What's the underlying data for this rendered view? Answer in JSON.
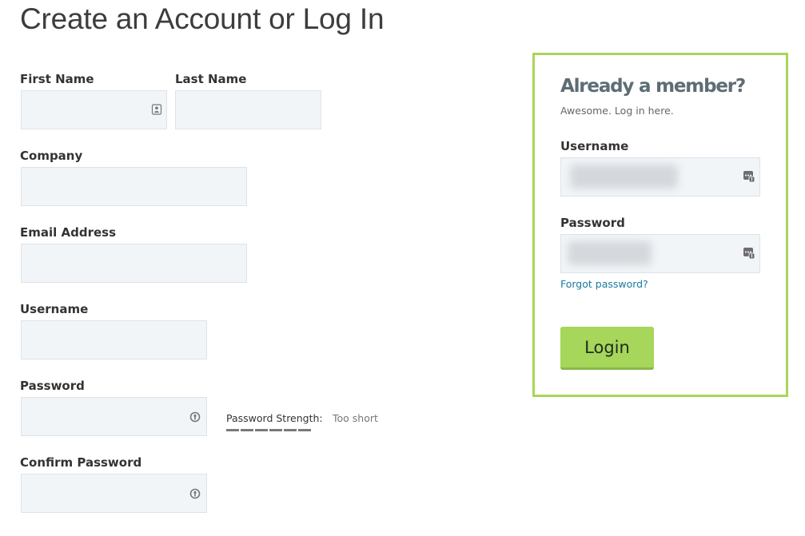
{
  "page": {
    "title": "Create an Account or Log In"
  },
  "register": {
    "first_name": {
      "label": "First Name",
      "value": ""
    },
    "last_name": {
      "label": "Last Name",
      "value": ""
    },
    "company": {
      "label": "Company",
      "value": ""
    },
    "email": {
      "label": "Email Address",
      "value": ""
    },
    "username": {
      "label": "Username",
      "value": ""
    },
    "password": {
      "label": "Password",
      "value": ""
    },
    "confirm_password": {
      "label": "Confirm Password",
      "value": ""
    },
    "strength": {
      "label": "Password Strength:",
      "value": "Too short",
      "segments_filled": 6
    }
  },
  "login": {
    "heading": "Already a member?",
    "subtext": "Awesome. Log in here.",
    "username_label": "Username",
    "password_label": "Password",
    "forgot_link": "Forgot password?",
    "button_label": "Login"
  },
  "icons": {
    "contact_card": "contact-card-icon",
    "password_key": "password-key-icon",
    "password_manager": "password-manager-icon"
  },
  "colors": {
    "accent_green": "#a6d65a",
    "panel_border": "#aad55b",
    "field_bg": "#f1f5f8",
    "link": "#1a7aa0",
    "heading_slate": "#5d6d74"
  }
}
